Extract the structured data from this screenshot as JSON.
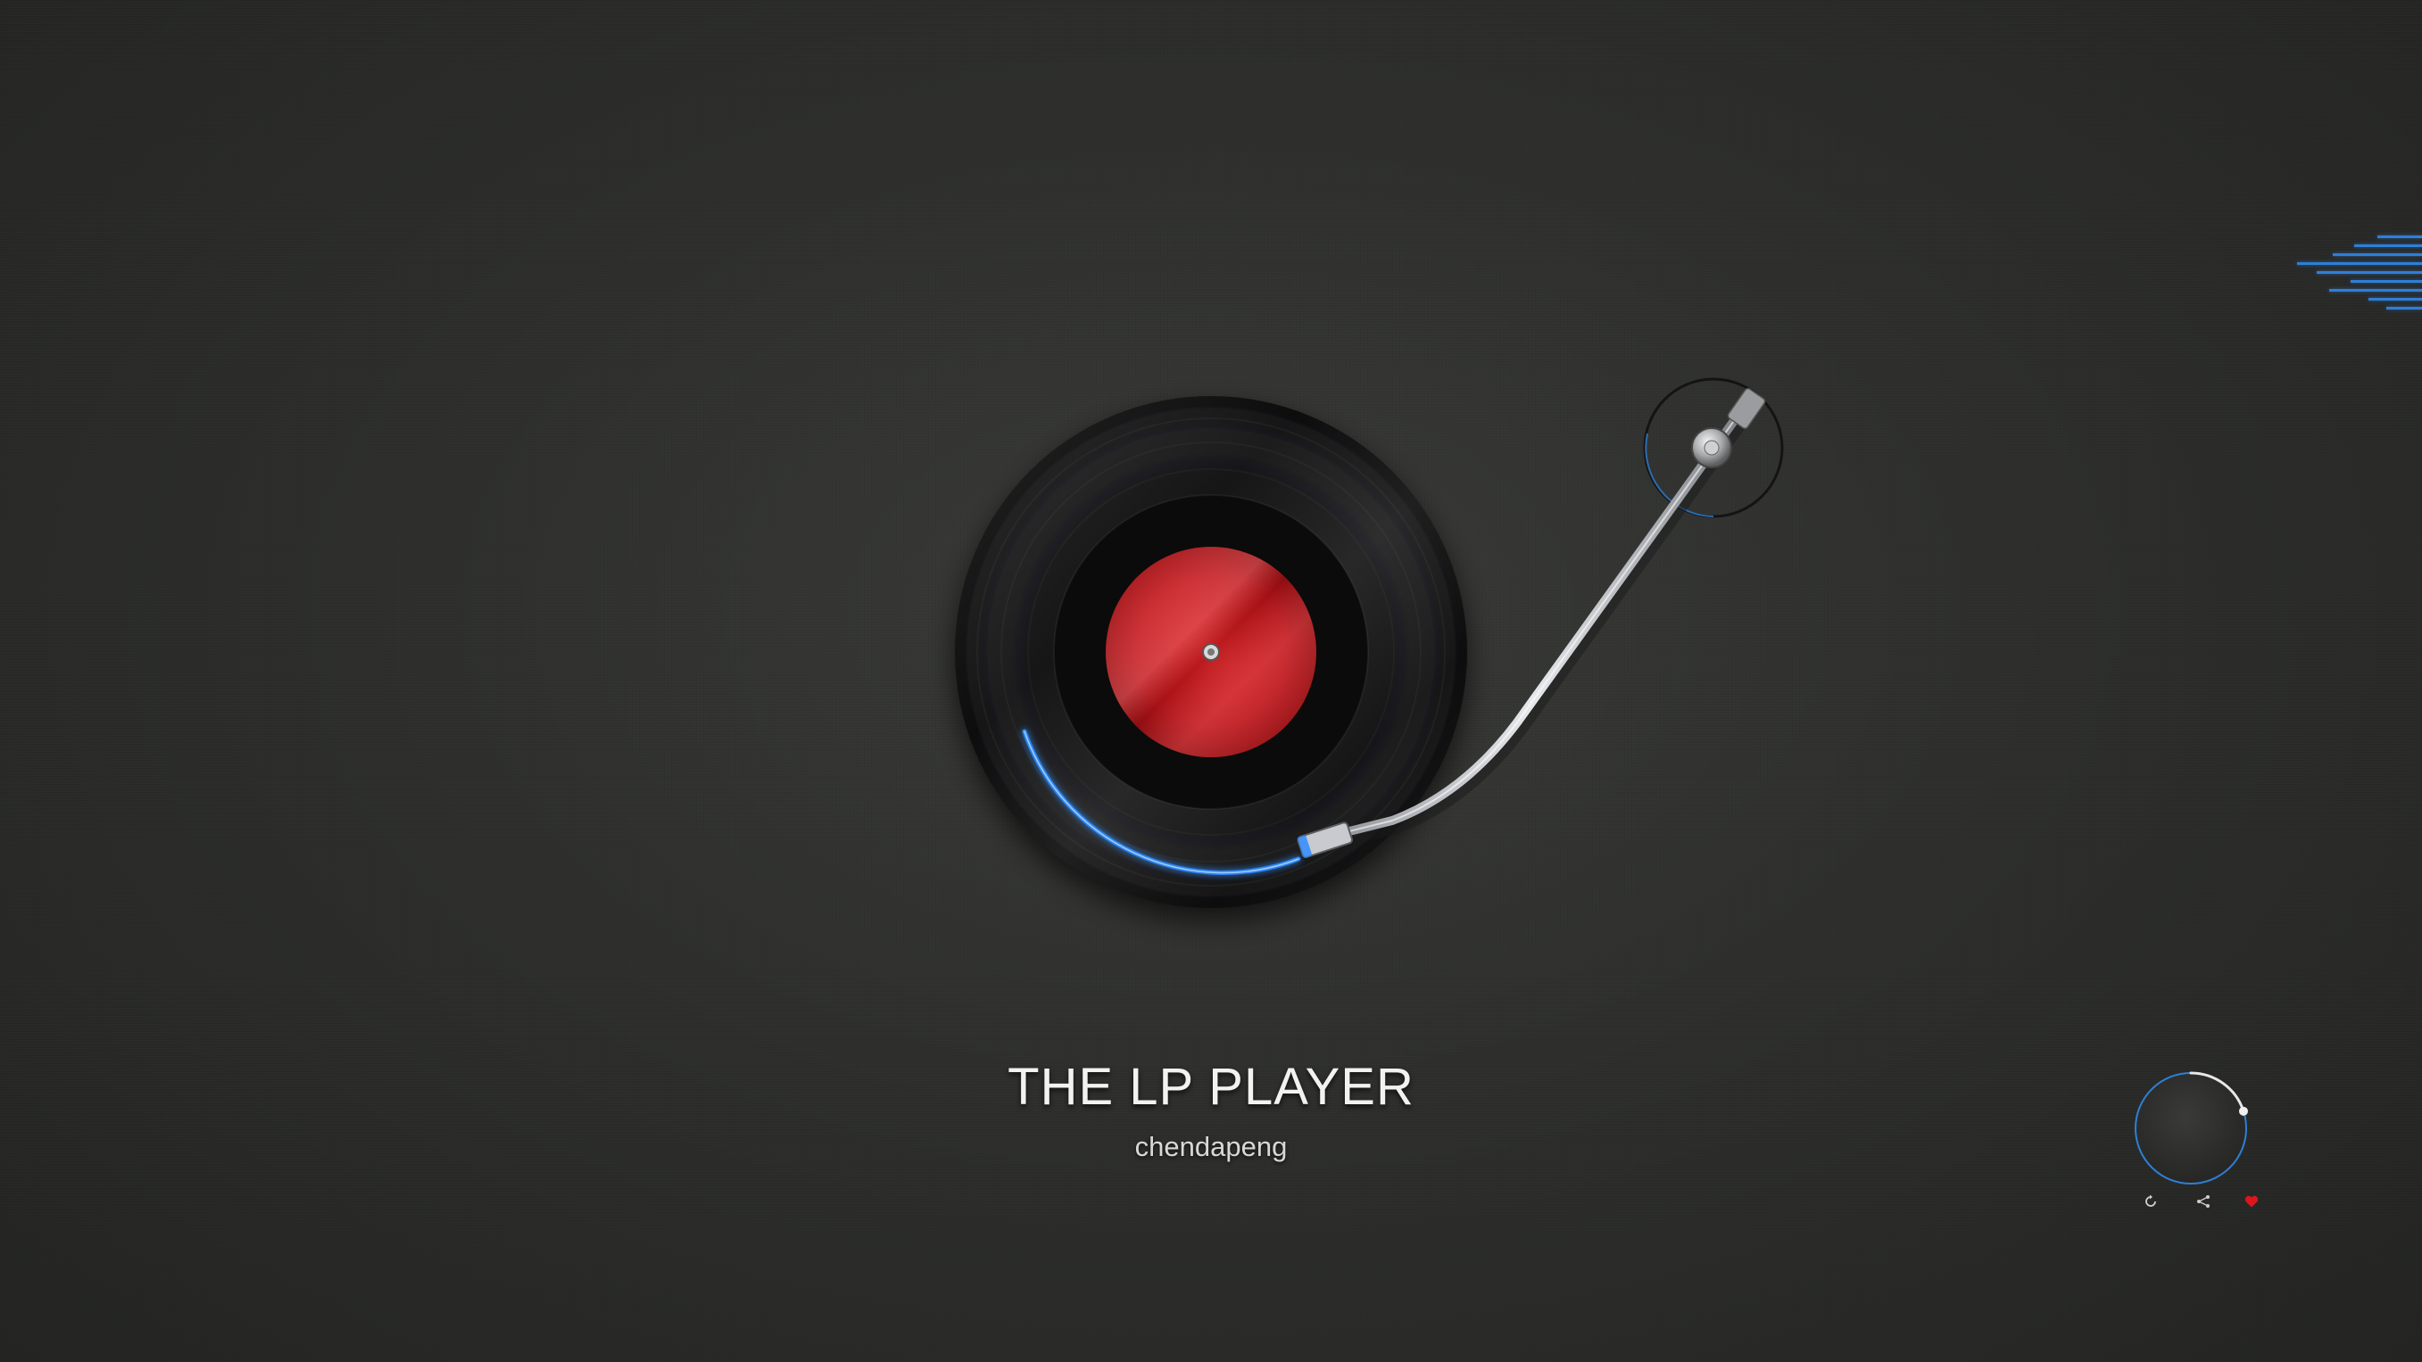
{
  "player": {
    "title": "THE LP PLAYER",
    "artist": "chendapeng"
  },
  "record": {
    "label_color": "#d0161a",
    "progress_glow_color": "#2f8cff"
  },
  "volume_knob": {
    "accent": "#2f7fd6",
    "level": 0.2
  },
  "controls": {
    "icons": [
      "replay-icon",
      "share-icon",
      "heart-icon"
    ],
    "heart_color": "#e0141b"
  },
  "menu": {
    "icon": "menu-lines-icon",
    "color": "#2f7fd6"
  }
}
